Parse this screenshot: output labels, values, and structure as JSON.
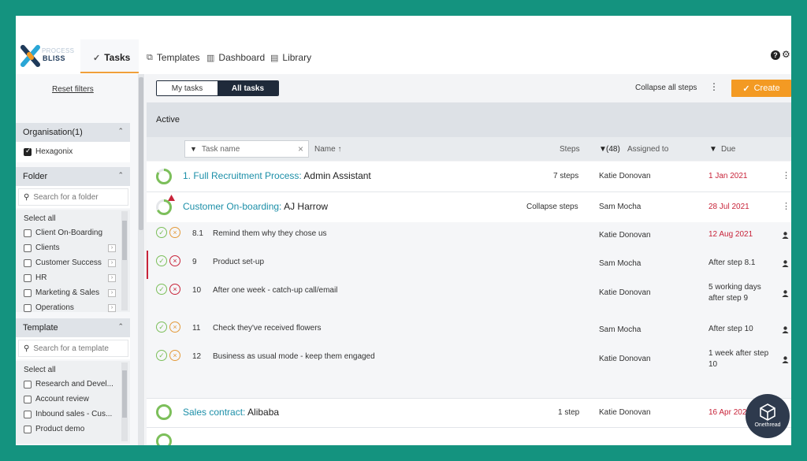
{
  "app": {
    "logo_top": "PROCESS",
    "logo_bottom": "BLISS"
  },
  "nav": {
    "tabs": [
      {
        "label": "Tasks",
        "icon": "check-icon"
      },
      {
        "label": "Templates",
        "icon": "template-icon"
      },
      {
        "label": "Dashboard",
        "icon": "chart-icon"
      },
      {
        "label": "Library",
        "icon": "book-icon"
      }
    ],
    "help": "?",
    "settings": "⚙"
  },
  "sidebar": {
    "reset_filters": "Reset filters",
    "organisation": {
      "title": "Organisation(1)",
      "items": [
        {
          "label": "Hexagonix",
          "checked": true
        }
      ]
    },
    "folder": {
      "title": "Folder",
      "search_placeholder": "Search for a folder",
      "select_all": "Select all",
      "items": [
        "Client On-Boarding",
        "Clients",
        "Customer Success",
        "HR",
        "Marketing & Sales",
        "Operations"
      ]
    },
    "template": {
      "title": "Template",
      "search_placeholder": "Search for a template",
      "select_all": "Select all",
      "items": [
        "Research and Devel...",
        "Account review",
        "Inbound sales - Cus...",
        "Product demo"
      ]
    }
  },
  "main": {
    "toggle": {
      "my_tasks": "My tasks",
      "all_tasks": "All tasks"
    },
    "collapse_all": "Collapse all steps",
    "create": "Create",
    "section": "Active",
    "header": {
      "task_name_placeholder": "Task name",
      "name": "Name ↑",
      "steps": "Steps",
      "assigned_count": "(48)",
      "assigned_to": "Assigned to",
      "due": "Due"
    },
    "tasks": [
      {
        "prefix": "1. Full Recruitment Process:",
        "name": " Admin Assistant",
        "steps": "7 steps",
        "assignee": "Katie Donovan",
        "due": "1 Jan 2021"
      },
      {
        "prefix": "Customer On-boarding:",
        "name": " AJ Harrow",
        "steps": "Collapse steps",
        "assignee": "Sam Mocha",
        "due": "28 Jul 2021"
      }
    ],
    "steps": [
      {
        "num": "8.1",
        "title": "Remind them why they chose us",
        "assignee": "Katie Donovan",
        "due": "12 Aug 2021",
        "due_red": true
      },
      {
        "num": "9",
        "title": "Product set-up",
        "assignee": "Sam Mocha",
        "due": "After step 8.1",
        "due_red": false
      },
      {
        "num": "10",
        "title": "After one week - catch-up call/email",
        "assignee": "Katie Donovan",
        "due": "5 working days",
        "due2": "after step 9",
        "due_red": false
      },
      {
        "num": "11",
        "title": "Check they've received flowers",
        "assignee": "Sam Mocha",
        "due": "After step 10",
        "due_red": false
      },
      {
        "num": "12",
        "title": "Business as usual mode - keep them engaged",
        "assignee": "Katie Donovan",
        "due": "1 week after step",
        "due2": "10",
        "due_red": false
      }
    ],
    "last_task": {
      "prefix": "Sales contract:",
      "name": " Alibaba",
      "steps": "1 step",
      "assignee": "Katie Donovan",
      "due": "16 Apr 2021"
    }
  },
  "badge": {
    "label": "Onethread"
  },
  "colors": {
    "accent": "#f39a23",
    "teal": "#1c8fa8",
    "red": "#c8243a",
    "background": "#14937f"
  }
}
